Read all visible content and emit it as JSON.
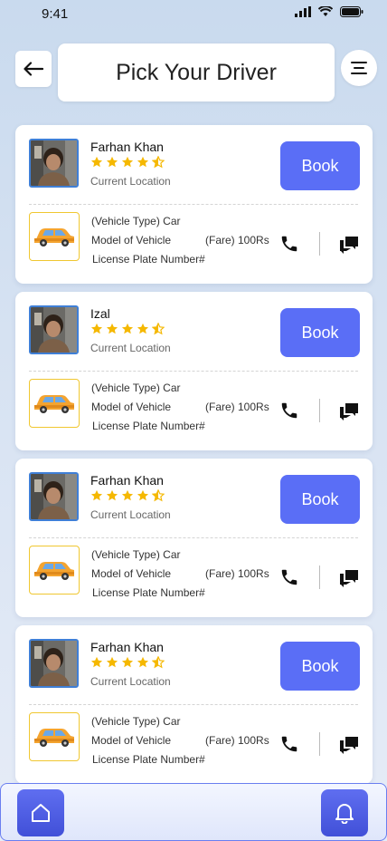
{
  "status": {
    "time": "9:41"
  },
  "header": {
    "title": "Pick Your Driver"
  },
  "colors": {
    "accent": "#5a6ef6",
    "star": "#f5b800",
    "car_border": "#f0c730"
  },
  "drivers": [
    {
      "name": "Farhan Khan",
      "rating": 4.5,
      "location": "Current Location",
      "book_label": "Book",
      "vehicle_type": "(Vehicle Type) Car",
      "model": "Model of Vehicle",
      "fare": "(Fare) 100Rs",
      "plate": "License Plate Number#"
    },
    {
      "name": "Izal",
      "rating": 4.5,
      "location": "Current Location",
      "book_label": "Book",
      "vehicle_type": "(Vehicle Type) Car",
      "model": "Model of Vehicle",
      "fare": "(Fare) 100Rs",
      "plate": "License Plate Number#"
    },
    {
      "name": "Farhan Khan",
      "rating": 4.5,
      "location": "Current Location",
      "book_label": "Book",
      "vehicle_type": "(Vehicle Type) Car",
      "model": "Model of Vehicle",
      "fare": "(Fare) 100Rs",
      "plate": "License Plate Number#"
    },
    {
      "name": "Farhan Khan",
      "rating": 4.5,
      "location": "Current Location",
      "book_label": "Book",
      "vehicle_type": "(Vehicle Type) Car",
      "model": "Model of Vehicle",
      "fare": "(Fare) 100Rs",
      "plate": "License Plate Number#"
    }
  ],
  "icons": {
    "back": "arrow-left-icon",
    "menu": "menu-icon",
    "call": "phone-icon",
    "chat": "chat-icon",
    "home": "home-icon",
    "notifications": "bell-icon"
  }
}
